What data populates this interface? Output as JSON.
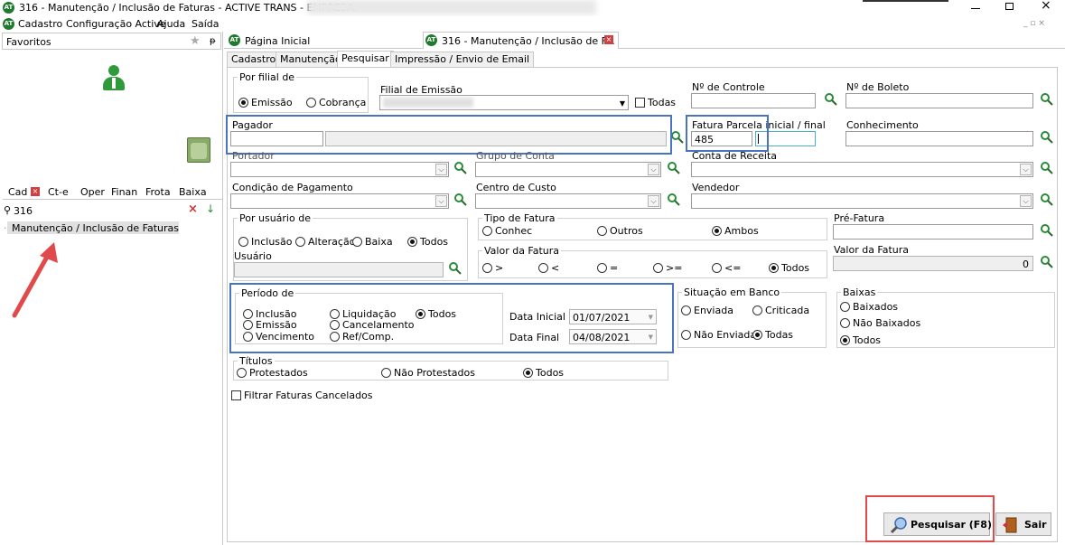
{
  "window": {
    "title": "316 - Manutenção / Inclusão de Faturas - ACTIVE TRANS - EMPRESA:",
    "app_icon": "AT"
  },
  "menu": [
    "Cadastro",
    "Configuração Active",
    "Ajuda",
    "Saída"
  ],
  "favorites": {
    "label": "Favoritos"
  },
  "left_tabs": [
    "Cad",
    "Ct-e",
    "Oper",
    "Finan",
    "Frota",
    "Baixa"
  ],
  "search": {
    "value": "316"
  },
  "tree": {
    "item": "Manutenção / Inclusão de Faturas"
  },
  "doc_tabs": [
    "Página Inicial",
    "316 - Manutenção / Inclusão de F..."
  ],
  "sub_tabs": [
    "Cadastro",
    "Manutenção",
    "Pesquisar",
    "Impressão / Envio de Email"
  ],
  "por_filial": {
    "legend": "Por filial de",
    "options": [
      "Emissão",
      "Cobrança"
    ],
    "selected": "Emissão"
  },
  "filial_emissao": {
    "label": "Filial de Emissão",
    "todas": "Todas"
  },
  "controle": {
    "label": "Nº de Controle"
  },
  "boleto": {
    "label": "Nº de Boleto"
  },
  "pagador": {
    "label": "Pagador"
  },
  "fatura_parcela": {
    "label": "Fatura Parcela inicial / final",
    "value": "485"
  },
  "conhecimento": {
    "label": "Conhecimento"
  },
  "portador": {
    "label": "Portador"
  },
  "grupo_conta": {
    "label": "Grupo de Conta"
  },
  "conta_receita": {
    "label": "Conta de Receita"
  },
  "cond_pagamento": {
    "label": "Condição de Pagamento"
  },
  "centro_custo": {
    "label": "Centro de Custo"
  },
  "vendedor": {
    "label": "Vendedor"
  },
  "por_usuario": {
    "legend": "Por usuário de",
    "options": [
      "Inclusão",
      "Alteração",
      "Baixa",
      "Todos"
    ],
    "selected": "Todos",
    "usuario_label": "Usuário"
  },
  "tipo_fatura": {
    "legend": "Tipo de Fatura",
    "options": [
      "Conhec",
      "Outros",
      "Ambos"
    ],
    "selected": "Ambos"
  },
  "valor_fatura_ops": {
    "legend": "Valor da Fatura",
    "options": [
      ">",
      "<",
      "=",
      ">=",
      "<=",
      "Todos"
    ],
    "selected": "Todos"
  },
  "pre_fatura": {
    "label": "Pré-Fatura"
  },
  "valor_fatura": {
    "label": "Valor da Fatura",
    "value": "0"
  },
  "periodo": {
    "legend": "Período de",
    "col1": [
      "Inclusão",
      "Emissão",
      "Vencimento"
    ],
    "col2": [
      "Liquidação",
      "Cancelamento",
      "Ref/Comp."
    ],
    "todos": "Todos",
    "selected": "Todos",
    "data_inicial_label": "Data Inicial",
    "data_inicial": "01/07/2021",
    "data_final_label": "Data Final",
    "data_final": "04/08/2021"
  },
  "situacao_banco": {
    "legend": "Situação em Banco",
    "options": [
      "Enviada",
      "Criticada",
      "Não Enviada",
      "Todas"
    ],
    "selected": "Todas"
  },
  "baixas": {
    "legend": "Baixas",
    "options": [
      "Baixados",
      "Não Baixados",
      "Todos"
    ],
    "selected": "Todos"
  },
  "titulos": {
    "legend": "Títulos",
    "options": [
      "Protestados",
      "Não Protestados",
      "Todos"
    ],
    "selected": "Todos"
  },
  "filtrar_canceladas": {
    "label": "Filtrar Faturas Cancelados"
  },
  "buttons": {
    "pesquisar": "Pesquisar (F8)",
    "sair": "Sair"
  },
  "colors": {
    "highlight_blue": "#4a74c0",
    "highlight_red": "#e04a4a",
    "icon_green": "#2a8a3a"
  }
}
